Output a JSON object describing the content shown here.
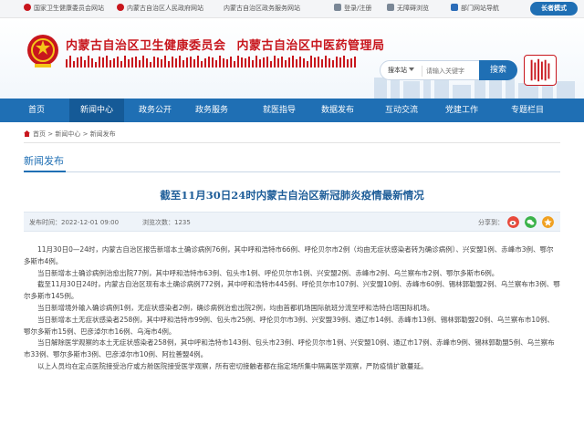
{
  "topbar": {
    "links": [
      "国家卫生健康委员会网站",
      "内蒙古自治区人民政府网站",
      "内蒙古自治区政务服务网站"
    ],
    "login": "登录/注册",
    "accessible": "无障碍浏览",
    "dept_nav": "部门网站导航",
    "elder_mode": "长者模式"
  },
  "header": {
    "title_1": "内蒙古自治区卫生健康委员会",
    "title_2": "内蒙古自治区中医药管理局",
    "search": {
      "scope": "搜本站",
      "placeholder": "请输入关键字",
      "button": "搜索"
    }
  },
  "nav": {
    "items": [
      "首页",
      "新闻中心",
      "政务公开",
      "政务服务",
      "就医指导",
      "数据发布",
      "互动交流",
      "党建工作",
      "专题栏目"
    ]
  },
  "breadcrumb": {
    "items": [
      "首页",
      "新闻中心",
      "新闻发布"
    ],
    "sep": ">"
  },
  "section": {
    "title": "新闻发布"
  },
  "article": {
    "title": "截至11月30日24时内蒙古自治区新冠肺炎疫情最新情况",
    "publish_label": "发布时间：",
    "publish_time": "2022-12-01 09:00",
    "views_label": "浏览次数：",
    "views": "1235",
    "share_label": "分享到：",
    "paragraphs": [
      "11月30日0—24时，内蒙古自治区报告新增本土确诊病例76例，其中呼和浩特市66例、呼伦贝尔市2例（均由无症状感染者转为确诊病例）、兴安盟1例、赤峰市3例、鄂尔多斯市4例。",
      "当日新增本土确诊病例治愈出院77例，其中呼和浩特市63例、包头市1例、呼伦贝尔市1例、兴安盟2例、赤峰市2例、乌兰察布市2例、鄂尔多斯市6例。",
      "截至11月30日24时，内蒙古自治区现有本土确诊病例772例，其中呼和浩特市445例、呼伦贝尔市107例、兴安盟10例、赤峰市60例、锡林郭勒盟2例、乌兰察布市3例、鄂尔多斯市145例。",
      "当日新增境外输入确诊病例1例，无症状感染者2例，确诊病例治愈出院2例，均由首都机场国际航班分流至呼和浩特白塔国际机场。",
      "当日新增本土无症状感染者258例，其中呼和浩特市99例、包头市25例、呼伦贝尔市3例、兴安盟39例、通辽市14例、赤峰市13例、锡林郭勒盟20例、乌兰察布市10例、鄂尔多斯市15例、巴彦淖尔市16例、乌海市4例。",
      "当日解除医学观察的本土无症状感染者258例，其中呼和浩特市143例、包头市23例、呼伦贝尔市1例、兴安盟10例、通辽市17例、赤峰市9例、锡林郭勒盟5例、乌兰察布市33例、鄂尔多斯市3例、巴彦淖尔市10例、阿拉善盟4例。",
      "以上人员均在定点医院接受治疗或方舱医院接受医学观察，所有密切接触者都在指定场所集中隔离医学观察，严防疫情扩散蔓延。"
    ]
  },
  "colors": {
    "brand_red": "#c8161d",
    "nav_blue": "#1f6fb4",
    "title_blue": "#1f5e99",
    "wechat_green": "#3bb34a",
    "weibo_orange": "#f0a020"
  }
}
